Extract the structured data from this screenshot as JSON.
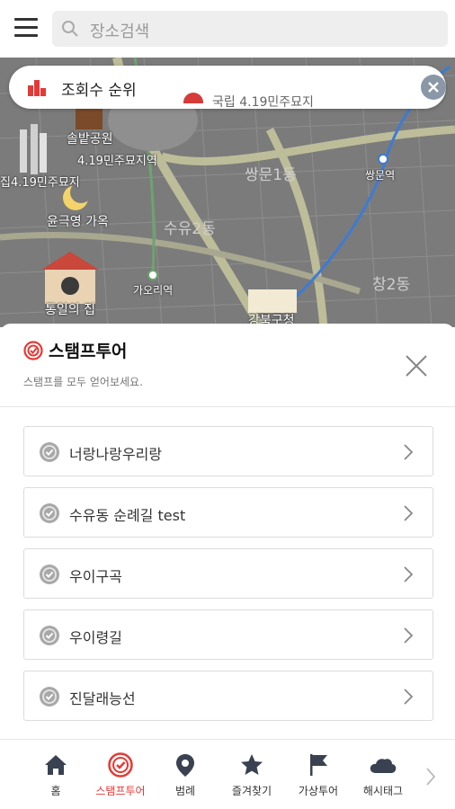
{
  "search": {
    "placeholder": "장소검색"
  },
  "map": {
    "labels": {
      "songbeop": "솔밭공원",
      "station419": "4.19민주묘지역",
      "station419b": "집4.19민주묘지",
      "ssangmun1": "쌍문1동",
      "ssangmun_st": "쌍문역",
      "suyu2": "수유2동",
      "yungeuk": "윤극영 가옥",
      "gaori": "가오리역",
      "chang2": "창2동",
      "tongil": "통일의 집",
      "gangbuk": "강북구청"
    }
  },
  "ranking": {
    "label": "조회수 순위",
    "ticker": "국립 4.19민주묘지"
  },
  "sheet": {
    "title": "스탬프투어",
    "subtitle": "스탬프를 모두 얻어보세요.",
    "items": [
      {
        "label": "너랑나랑우리랑"
      },
      {
        "label": "수유동 순례길 test"
      },
      {
        "label": "우이구곡"
      },
      {
        "label": "우이령길"
      },
      {
        "label": "진달래능선"
      }
    ]
  },
  "nav": {
    "tabs": [
      {
        "label": "홈",
        "icon": "home-icon"
      },
      {
        "label": "스탬프투어",
        "icon": "stamp-icon",
        "active": true
      },
      {
        "label": "범례",
        "icon": "pin-icon"
      },
      {
        "label": "즐겨찾기",
        "icon": "star-icon"
      },
      {
        "label": "가상투어",
        "icon": "flag-icon"
      },
      {
        "label": "해시태그",
        "icon": "cloud-icon"
      }
    ]
  },
  "colors": {
    "accent": "#e53935",
    "nav_icon": "#3a4150",
    "map_bg": "#7d7d7d"
  }
}
